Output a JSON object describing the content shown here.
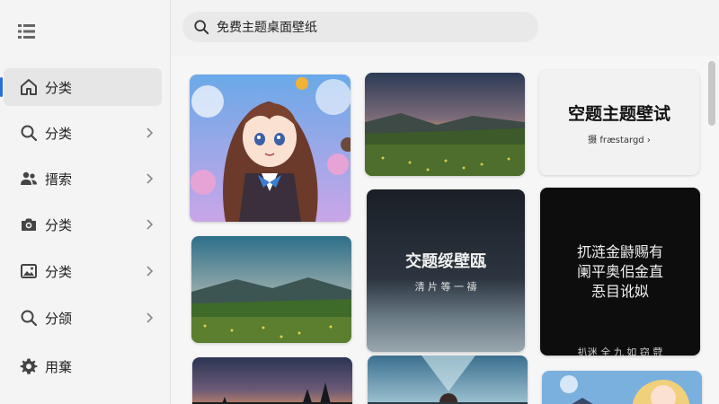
{
  "search": {
    "value": "免费主题桌面壁纸"
  },
  "sidebar": {
    "items": [
      {
        "label": "分类",
        "icon": "home-icon",
        "active": true,
        "chevron": false
      },
      {
        "label": "分类",
        "icon": "search-icon",
        "active": false,
        "chevron": true
      },
      {
        "label": "搢索",
        "icon": "people-icon",
        "active": false,
        "chevron": true
      },
      {
        "label": "分类",
        "icon": "camera-icon",
        "active": false,
        "chevron": true
      },
      {
        "label": "分类",
        "icon": "image-icon",
        "active": false,
        "chevron": true
      },
      {
        "label": "分颌",
        "icon": "search-icon",
        "active": false,
        "chevron": true
      },
      {
        "label": "用棄",
        "icon": "gear-icon",
        "active": false,
        "chevron": false
      }
    ]
  },
  "gallery": {
    "card_top_right": {
      "title": "空题主题壁试",
      "subtitle": "摄 fræstargd  ›"
    },
    "card_mid_center": {
      "title": "交题绥壁瓯",
      "subtitle": "淸 片 等 一 禱"
    },
    "card_mid_right": {
      "lines": [
        "扤涟金鼭赐有",
        "阑平奥佀金直",
        "忢目讹姒"
      ],
      "bottom": "扒迷 全 九 如 窃 蒄"
    }
  },
  "colors": {
    "accent": "#2b6fd6",
    "sidebar_bg": "#f4f4f4",
    "active_bg": "#e6e6e6"
  }
}
